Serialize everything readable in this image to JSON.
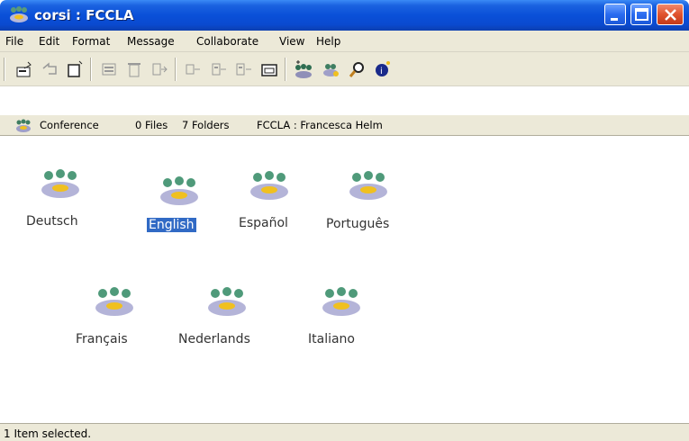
{
  "window": {
    "title": "corsi : FCCLA",
    "controls": [
      "minimize",
      "maximize",
      "close"
    ]
  },
  "menu": {
    "items": [
      "File",
      "Edit",
      "Format",
      "Message",
      "Collaborate",
      "View",
      "Help"
    ]
  },
  "toolbar": {
    "icons": [
      "new-message-icon",
      "reply-icon",
      "new-document-icon",
      "print-icon",
      "delete-icon",
      "move-icon",
      "previous-icon",
      "next-icon",
      "open-folder-icon",
      "conference-icon",
      "users-icon",
      "search-icon",
      "info-icon"
    ]
  },
  "infobar": {
    "type": "Conference",
    "files": "0 Files",
    "folders": "7 Folders",
    "path": "FCCLA : Francesca Helm"
  },
  "folders": [
    {
      "label": "Deutsch",
      "selected": false
    },
    {
      "label": "English",
      "selected": true
    },
    {
      "label": "Español",
      "selected": false
    },
    {
      "label": "Português",
      "selected": false
    },
    {
      "label": "Français",
      "selected": false
    },
    {
      "label": "Nederlands",
      "selected": false
    },
    {
      "label": "Italiano",
      "selected": false
    }
  ],
  "status": {
    "text": "1 Item selected."
  },
  "colors": {
    "titlebar": "#0a50d8",
    "selection": "#316ac5",
    "chrome": "#ece9d8"
  }
}
